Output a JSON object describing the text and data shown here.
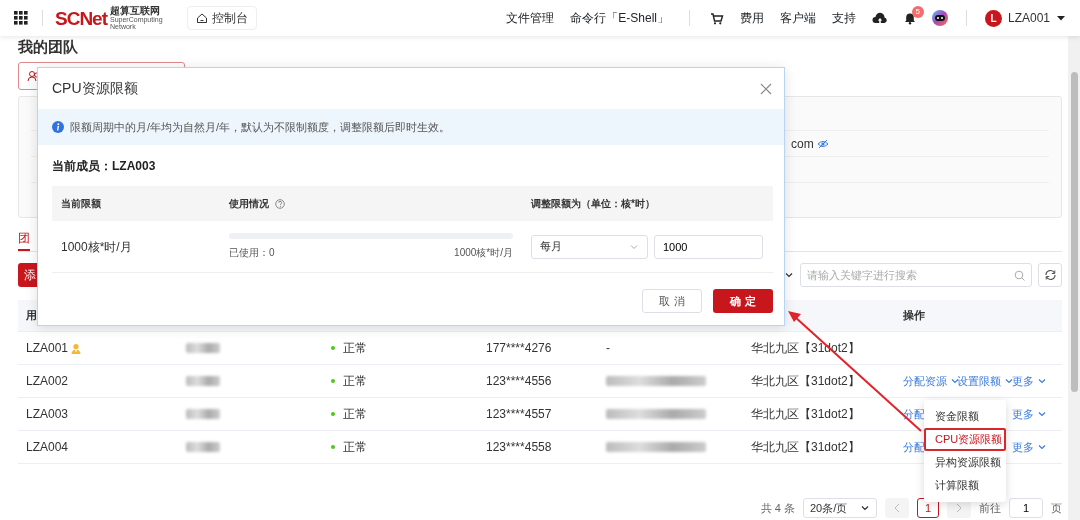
{
  "header": {
    "logo": {
      "wordmark": "SCNet",
      "cn": "超算互联网",
      "en": [
        "SuperComputing",
        "Network"
      ]
    },
    "console_button": "控制台",
    "nav": [
      "文件管理",
      "命令行「E-Shell」"
    ],
    "links": [
      "费用",
      "客户端",
      "支持"
    ],
    "notification_count": "5",
    "user": {
      "initial": "L",
      "name": "LZA001"
    }
  },
  "page_title": "我的团队",
  "info_panel": {
    "email_value": "com"
  },
  "tabs": [
    {
      "label": "团",
      "selected": true
    }
  ],
  "add_button": "添",
  "search": {
    "placeholder": "请输入关键字进行搜索"
  },
  "table": {
    "columns": [
      "用",
      "操作"
    ],
    "rows": [
      {
        "username": "LZA001",
        "admin": true,
        "status": "正常",
        "phone": "177****4276",
        "email": "-",
        "region": "华北九区【31dot2】"
      },
      {
        "username": "LZA002",
        "admin": false,
        "status": "正常",
        "phone": "123****4556",
        "region": "华北九区【31dot2】",
        "actions": {
          "assign": {
            "label": "分配资源",
            "caret": true
          },
          "limit": {
            "label": "设置限额",
            "caret": true
          },
          "more": {
            "label": "更多",
            "caret": true
          }
        }
      },
      {
        "username": "LZA003",
        "admin": false,
        "status": "正常",
        "phone": "123****4557",
        "region": "华北九区【31dot2】",
        "actions": {
          "assign": {
            "label": "分配",
            "caret": false
          },
          "more": {
            "label": "更多",
            "caret": true
          }
        }
      },
      {
        "username": "LZA004",
        "admin": false,
        "status": "正常",
        "phone": "123****4558",
        "region": "华北九区【31dot2】",
        "actions": {
          "assign": {
            "label": "分配",
            "caret": false
          },
          "more": {
            "label": "更多",
            "caret": true
          }
        }
      }
    ]
  },
  "limit_menu": {
    "items": [
      {
        "label": "资金限额",
        "selected": false
      },
      {
        "label": "CPU资源限额",
        "selected": true
      },
      {
        "label": "异构资源限额",
        "selected": false
      },
      {
        "label": "计算限额",
        "selected": false
      }
    ]
  },
  "pagination": {
    "total": "共 4 条",
    "page_size": "20条/页",
    "current": "1",
    "goto_label": "前往",
    "goto_value": "1",
    "page_suffix": "页"
  },
  "modal": {
    "title": "CPU资源限额",
    "notice": "限额周期中的月/年均为自然月/年，默认为不限制额度，调整限额后即时生效。",
    "member": "当前成员：LZA003",
    "columns": [
      "当前限额",
      "使用情况",
      "调整限额为（单位：核*时）"
    ],
    "current_limit": "1000核*时/月",
    "usage": {
      "level": 0,
      "used": "已使用：0",
      "total": "1000核*时/月"
    },
    "period": "每月",
    "amount": "1000",
    "buttons": {
      "cancel": "取 消",
      "confirm": "确 定"
    }
  }
}
